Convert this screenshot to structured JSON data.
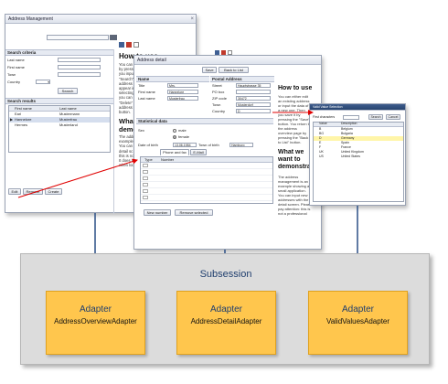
{
  "overview": {
    "title": "Address Management",
    "criteria_header": "Search criteria",
    "criteria": [
      "Last name",
      "First name",
      "Town",
      "Country"
    ],
    "search_label": "Search",
    "results_header": "Search results",
    "columns": [
      "First name",
      "Last name"
    ],
    "rows": [
      {
        "first": "Earl",
        "last": "Mustermann",
        "selected": false
      },
      {
        "first": "Hannelore",
        "last": "Musterfrau",
        "selected": true
      },
      {
        "first": "Hermes",
        "last": "Musterland",
        "selected": false
      }
    ],
    "buttons": [
      "Edit",
      "Remove",
      "Create"
    ],
    "howto_title": "How to use",
    "howto_lines": [
      "You can",
      "by pressi",
      "you input",
      "\"Search\" b",
      "address a",
      "appear in",
      "selecting",
      "you can",
      "\"Delete\" b",
      "address a",
      "button."
    ],
    "demo_title": "What",
    "demo_title2": "demons",
    "demo_lines": [
      "The addr",
      "example",
      "You can",
      "detail sc",
      "this is no",
      "It does n",
      "when loo"
    ]
  },
  "detail": {
    "title": "Address detail",
    "save_label": "Save",
    "back_label": "Back to List",
    "name_header": "Name",
    "name_fields": [
      {
        "label": "Title",
        "value": "Mrs."
      },
      {
        "label": "First name",
        "value": "Hannelore"
      },
      {
        "label": "Last name",
        "value": "Musterfrau"
      }
    ],
    "postal_header": "Postal Address",
    "postal_fields": [
      {
        "label": "Street",
        "value": "Hauptstrasse 35"
      },
      {
        "label": "PO box",
        "value": ""
      },
      {
        "label": "ZIP code",
        "value": "30472"
      },
      {
        "label": "Town",
        "value": "Musterdorf"
      },
      {
        "label": "Country",
        "value": "D"
      }
    ],
    "stat_header": "Statistical data",
    "sex_label": "Sex",
    "sex_options": [
      "male",
      "female"
    ],
    "dob_label": "Date of birth",
    "dob_value": "13.06.1984",
    "town_birth_label": "Town of birth",
    "town_birth_value": "Hamburg",
    "tabs": [
      "Phone and fax",
      "E-Mail"
    ],
    "phone_columns": [
      "Type",
      "Number"
    ],
    "new_number": "New number",
    "remove_selected": "Remove selected",
    "howto_title": "How to use",
    "howto_lines": [
      "You can either edit",
      "an existing address",
      "or input the data of",
      "a new one. Then",
      "you save it by",
      "pressing the \"Save\"",
      "button. You return to",
      "the address",
      "overview page by",
      "pressing the \"Back",
      "to List\" button."
    ],
    "demo_title1": "What we",
    "demo_title2": "want to",
    "demo_title3": "demonstra",
    "demo_lines": [
      "The address",
      "management is an",
      "example showing a",
      "small application.",
      "You can input new",
      "addresses with the",
      "detail screen. Please",
      "pay attention: this is",
      "not a professional"
    ]
  },
  "valid": {
    "title": "Valid Value Selection",
    "first_chars_label": "First characters",
    "search_label": "Search",
    "cancel_label": "Cancel",
    "columns": [
      "Value",
      "Description"
    ],
    "rows": [
      {
        "value": "B",
        "desc": "Belgium",
        "selected": false
      },
      {
        "value": "BG",
        "desc": "Bulgaria",
        "selected": false
      },
      {
        "value": "D",
        "desc": "Germany",
        "selected": true
      },
      {
        "value": "E",
        "desc": "Spain",
        "selected": false
      },
      {
        "value": "F",
        "desc": "France",
        "selected": false
      },
      {
        "value": "UK",
        "desc": "United Kingdom",
        "selected": false
      },
      {
        "value": "US",
        "desc": "United States",
        "selected": false
      }
    ]
  },
  "subsession": {
    "label": "Subsession",
    "adapters": [
      {
        "title": "Adapter",
        "name": "AddressOverviewAdapter"
      },
      {
        "title": "Adapter",
        "name": "AddressDetailAdapter"
      },
      {
        "title": "Adapter",
        "name": "ValidValuesAdapter"
      }
    ]
  },
  "colors": {
    "adapter_fill": "#ffc64d",
    "subsession_fill": "#dcdcdc",
    "connector": "#2b4f86",
    "red_arrow": "#e00000"
  }
}
